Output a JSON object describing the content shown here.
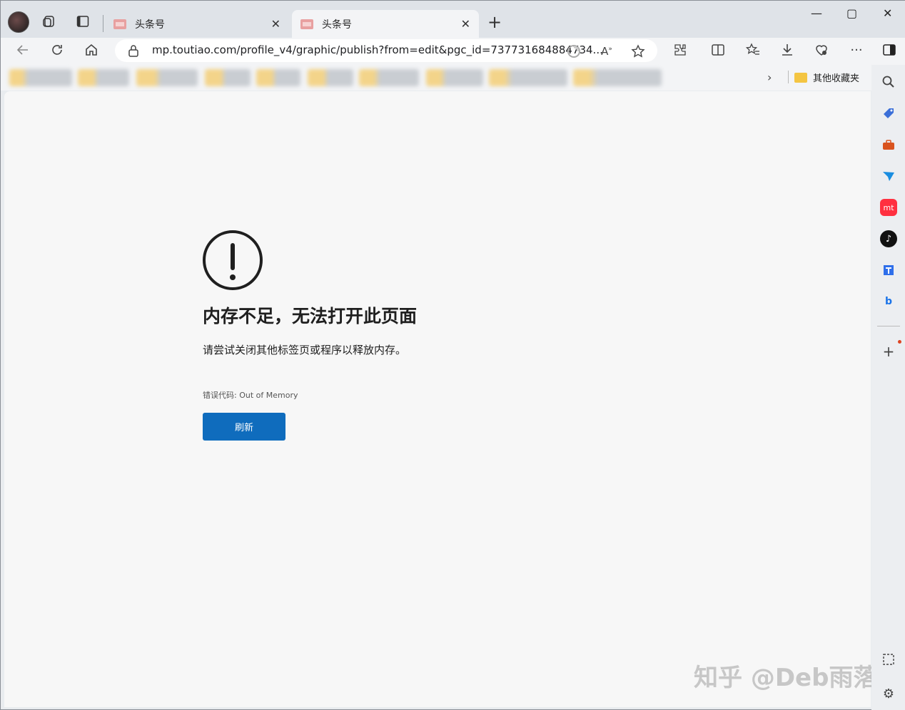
{
  "tabs": [
    {
      "title": "头条号"
    },
    {
      "title": "头条号"
    }
  ],
  "address_bar": {
    "url": "mp.toutiao.com/profile_v4/graphic/publish?from=edit&pgc_id=737731684884734..."
  },
  "favorites_bar": {
    "other_favorites_label": "其他收藏夹"
  },
  "error_page": {
    "title": "内存不足，无法打开此页面",
    "description": "请尝试关闭其他标签页或程序以释放内存。",
    "error_code": "错误代码: Out of Memory",
    "refresh_label": "刷新"
  },
  "sidebar": {
    "items": [
      {
        "icon": "search-icon"
      },
      {
        "icon": "shopping-tag-icon",
        "color": "#3b6fd8"
      },
      {
        "icon": "toolbox-icon",
        "color": "#d9531e"
      },
      {
        "icon": "send-icon",
        "color": "#1a8de0"
      },
      {
        "icon": "app-icon",
        "label": "mt",
        "color": "#ff3040"
      },
      {
        "icon": "tiktok-icon",
        "color": "#111111"
      },
      {
        "icon": "translate-icon",
        "color": "#2f6fea"
      },
      {
        "icon": "bing-icon",
        "color": "#1a73e8"
      },
      {
        "icon": "add-icon"
      }
    ]
  },
  "watermark": "知乎 @Deb雨落"
}
